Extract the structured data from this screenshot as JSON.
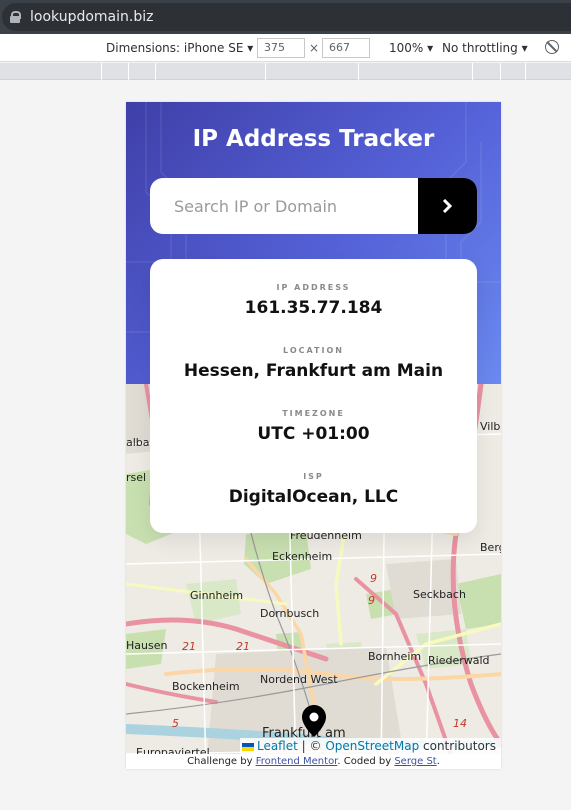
{
  "browser": {
    "url": "lookupdomain.biz",
    "device_label": "Dimensions: iPhone SE",
    "width_value": "375",
    "times_sign": "×",
    "height_value": "667",
    "zoom": "100%",
    "throttling": "No throttling"
  },
  "app": {
    "title": "IP Address Tracker",
    "search_placeholder": "Search IP or Domain",
    "info": [
      {
        "label": "IP ADDRESS",
        "value": "161.35.77.184"
      },
      {
        "label": "LOCATION",
        "value": "Hessen, Frankfurt am Main"
      },
      {
        "label": "TIMEZONE",
        "value": "UTC +01:00"
      },
      {
        "label": "ISP",
        "value": "DigitalOcean, LLC"
      }
    ]
  },
  "map": {
    "place_labels": [
      "Freudenheim",
      "Eckenheim",
      "Ginnheim",
      "Dornbusch",
      "Seckbach",
      "Bornheim",
      "Riederwald",
      "Nordend West",
      "Bockenheim",
      "Hausen",
      "Frankfurt am",
      "Berg",
      "Vilb",
      "albac",
      "rsel",
      "Europaviertel"
    ],
    "road_numbers": [
      "21",
      "21",
      "9",
      "9",
      "5",
      "14"
    ],
    "attribution": {
      "leaflet": "Leaflet",
      "separator": "| ©",
      "osm": "OpenStreetMap",
      "contributors": "contributors"
    }
  },
  "footer": {
    "prefix": "Challenge by",
    "mentor_link": "Frontend Mentor",
    "middle": ". Coded by",
    "author_link": "Serge St",
    "suffix": "."
  },
  "colors": {
    "hero_start": "#3f3fa8",
    "hero_end": "#6a8af0",
    "button_bg": "#000000",
    "link": "#0078a8"
  }
}
